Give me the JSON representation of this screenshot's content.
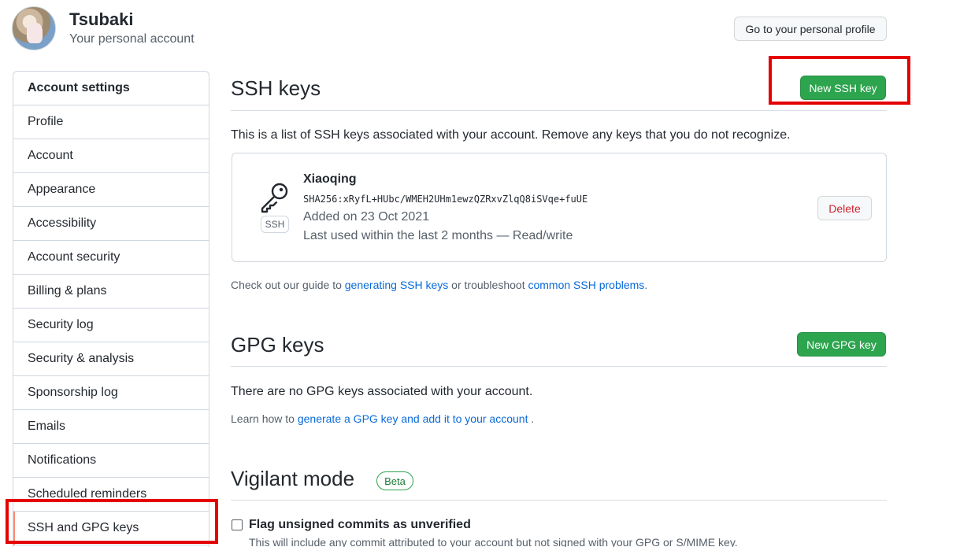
{
  "header": {
    "user_name": "Tsubaki",
    "user_subtitle": "Your personal account",
    "profile_button": "Go to your personal profile"
  },
  "sidebar": {
    "heading": "Account settings",
    "items": [
      {
        "label": "Profile"
      },
      {
        "label": "Account"
      },
      {
        "label": "Appearance"
      },
      {
        "label": "Accessibility"
      },
      {
        "label": "Account security"
      },
      {
        "label": "Billing & plans"
      },
      {
        "label": "Security log"
      },
      {
        "label": "Security & analysis"
      },
      {
        "label": "Sponsorship log"
      },
      {
        "label": "Emails"
      },
      {
        "label": "Notifications"
      },
      {
        "label": "Scheduled reminders"
      },
      {
        "label": "SSH and GPG keys",
        "active": true
      }
    ]
  },
  "ssh": {
    "title": "SSH keys",
    "new_button": "New SSH key",
    "description": "This is a list of SSH keys associated with your account. Remove any keys that you do not recognize.",
    "key": {
      "badge": "SSH",
      "name": "Xiaoqing",
      "fingerprint": "SHA256:xRyfL+HUbc/WMEH2UHm1ewzQZRxvZlqQ8iSVqe+fuUE",
      "added": "Added on 23 Oct 2021",
      "last_used": "Last used within the last 2 months — Read/write",
      "delete_button": "Delete"
    },
    "guide": {
      "prefix": "Check out our guide to ",
      "link1": "generating SSH keys",
      "middle": " or troubleshoot ",
      "link2": "common SSH problems",
      "suffix": "."
    }
  },
  "gpg": {
    "title": "GPG keys",
    "new_button": "New GPG key",
    "empty_text": "There are no GPG keys associated with your account.",
    "learn": {
      "prefix": "Learn how to ",
      "link": "generate a GPG key and add it to your account",
      "suffix": " ."
    }
  },
  "vigilant": {
    "title": "Vigilant mode",
    "badge": "Beta",
    "checkbox_label": "Flag unsigned commits as unverified",
    "checkbox_checked": false,
    "note": "This will include any commit attributed to your account but not signed with your GPG or S/MIME key."
  },
  "colors": {
    "primary_green": "#2da44e",
    "link_blue": "#0969da",
    "danger_red": "#cf222e",
    "highlight_red": "#e50000",
    "active_marker": "#fd8c73"
  },
  "icons": {
    "key": "key-icon"
  }
}
